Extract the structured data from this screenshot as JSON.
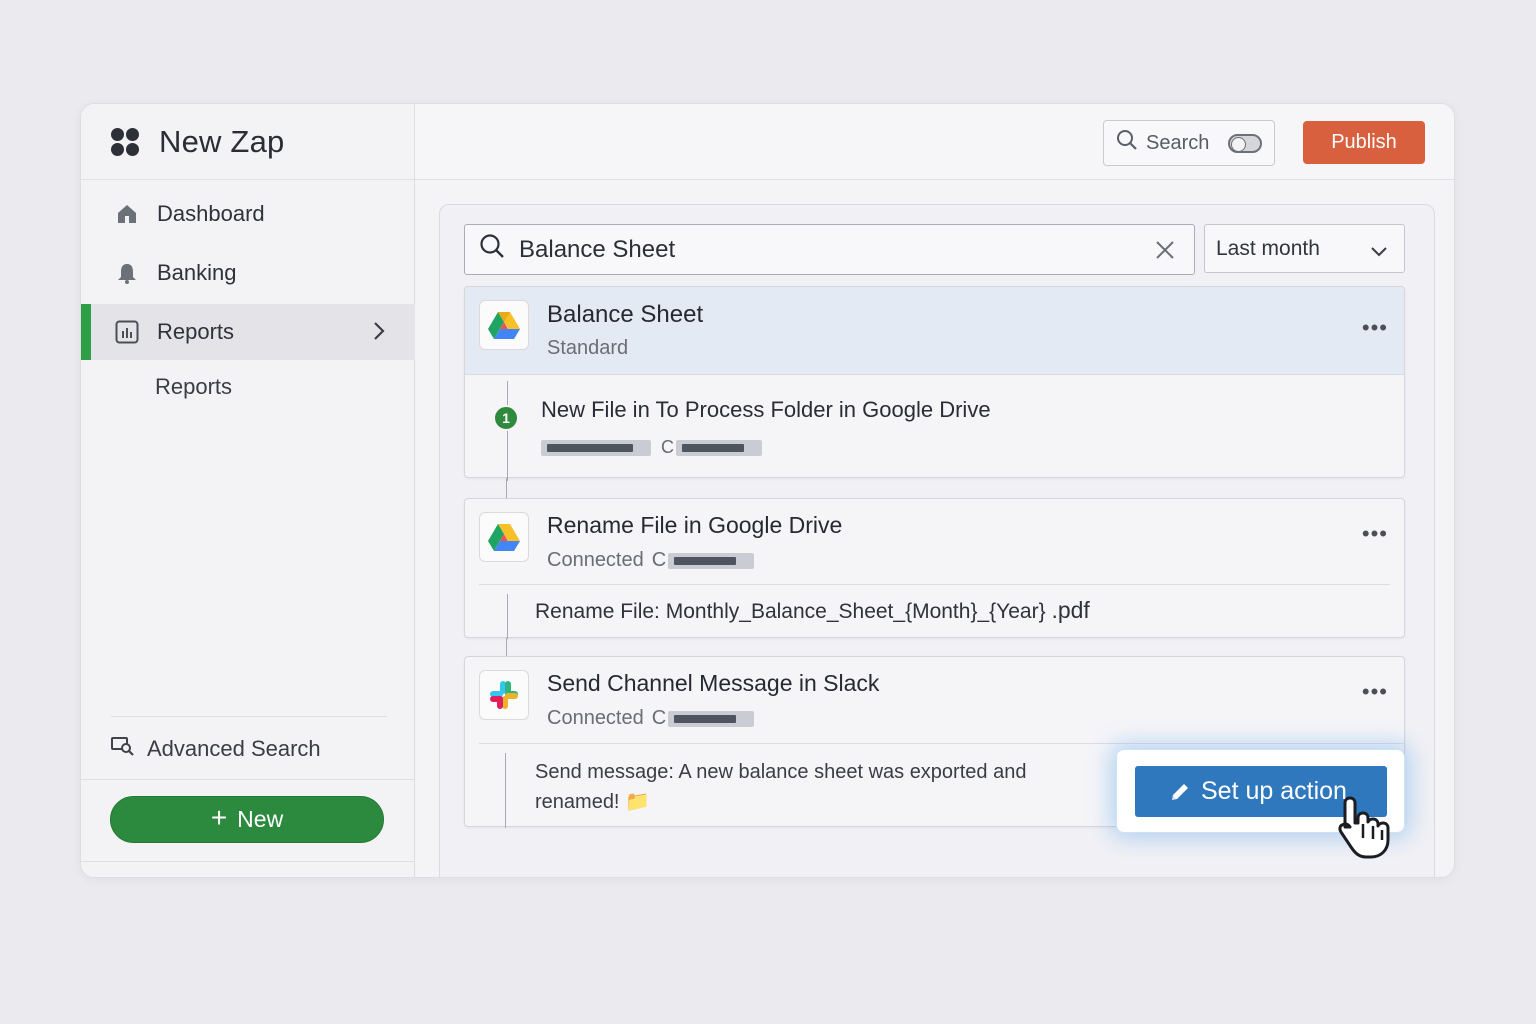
{
  "app": {
    "title": "New Zap"
  },
  "sidebar": {
    "items": [
      {
        "label": "Dashboard",
        "icon": "home-icon"
      },
      {
        "label": "Banking",
        "icon": "bell-icon"
      },
      {
        "label": "Reports",
        "icon": "bar-chart-icon",
        "active": true
      }
    ],
    "sub_item": "Reports",
    "advanced_search": "Advanced Search",
    "new_button": "New",
    "new_button_icon": "+"
  },
  "topbar": {
    "search_label": "Search",
    "search_toggle_on": false,
    "publish_label": "Publish"
  },
  "filters": {
    "search_value": "Balance Sheet",
    "period": "Last month"
  },
  "trigger": {
    "app": "Balance Sheet",
    "plan": "Standard",
    "step_number": "1",
    "step_title": "New File in To Process Folder in Google Drive",
    "step_meta_letter": "C"
  },
  "action_rename": {
    "title": "Rename File in Google Drive",
    "status": "Connected",
    "status_letter": "C",
    "detail_label": "Rename File:",
    "detail_value": "Monthly_Balance_Sheet_{Month}_{Year}",
    "detail_ext": ".pdf"
  },
  "action_slack": {
    "title": "Send Channel Message in Slack",
    "status": "Connected",
    "status_letter": "C",
    "message_line1": "Send message: A new balance sheet was exported and",
    "message_line2": "renamed! 📁"
  },
  "cta": {
    "label": "Set up action"
  },
  "more_label": "•••",
  "colors": {
    "accent_green": "#2b8a3e",
    "publish_orange": "#d9603f",
    "action_blue": "#2f78be",
    "active_row": "#e4eaf3"
  }
}
